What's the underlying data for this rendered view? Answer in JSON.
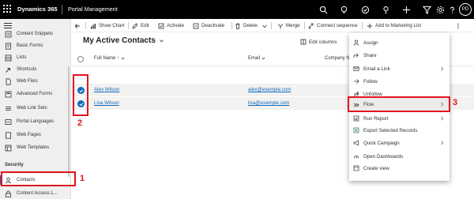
{
  "topbar": {
    "brand": "Dynamics 365",
    "app_name": "Portal Management",
    "avatar_initials": "PD",
    "icons": [
      "search-icon",
      "lightbulb-icon",
      "task-icon",
      "pin-icon",
      "plus-icon",
      "filter-icon",
      "gear-icon",
      "help-icon",
      "avatar"
    ]
  },
  "sidebar": {
    "items": [
      {
        "label": "Content Snippets",
        "icon": "snippet-icon"
      },
      {
        "label": "Basic Forms",
        "icon": "form-icon"
      },
      {
        "label": "Lists",
        "icon": "list-icon"
      },
      {
        "label": "Shortcuts",
        "icon": "shortcut-icon"
      },
      {
        "label": "Web Files",
        "icon": "file-icon"
      },
      {
        "label": "Advanced Forms",
        "icon": "form-icon"
      },
      {
        "label": "Web Link Sets",
        "icon": "link-icon"
      },
      {
        "label": "Portal Languages",
        "icon": "language-icon"
      },
      {
        "label": "Web Pages",
        "icon": "page-icon"
      },
      {
        "label": "Web Templates",
        "icon": "template-icon"
      }
    ],
    "section_label": "Security",
    "security_items": [
      {
        "label": "Contacts",
        "icon": "person-icon"
      },
      {
        "label": "Content Access L...",
        "icon": "lock-icon"
      }
    ]
  },
  "commandbar": {
    "back_icon": "back-arrow-icon",
    "items": [
      {
        "label": "Show Chart",
        "icon": "chart-icon"
      },
      {
        "label": "Edit",
        "icon": "edit-icon"
      },
      {
        "label": "Activate",
        "icon": "activate-icon"
      },
      {
        "label": "Deactivate",
        "icon": "deactivate-icon"
      },
      {
        "label": "Delete",
        "icon": "delete-icon"
      },
      {
        "label": "Merge",
        "icon": "merge-icon"
      },
      {
        "label": "Connect sequence",
        "icon": "sequence-icon"
      },
      {
        "label": "Add to Marketing List",
        "icon": "add-icon"
      }
    ],
    "more_icon": "more-icon"
  },
  "view": {
    "title": "My Active Contacts",
    "edit_columns": "Edit columns"
  },
  "grid": {
    "columns": [
      "Full Name ↑",
      "Email",
      "Company N"
    ],
    "rows": [
      {
        "name": "Alex Wilson",
        "email": "alex@example.com"
      },
      {
        "name": "Lisa Wilson",
        "email": "lisa@example.com"
      }
    ]
  },
  "flyout": {
    "items": [
      {
        "label": "Assign",
        "icon": "assign-icon",
        "chevron": false
      },
      {
        "label": "Share",
        "icon": "share-icon",
        "chevron": false
      },
      {
        "label": "Email a Link",
        "icon": "email-icon",
        "chevron": true
      },
      {
        "label": "Follow",
        "icon": "follow-icon",
        "chevron": false
      },
      {
        "label": "Unfollow",
        "icon": "unfollow-icon",
        "chevron": false
      },
      {
        "label": "Flow",
        "icon": "flow-icon",
        "chevron": true
      },
      {
        "label": "Run Report",
        "icon": "report-icon",
        "chevron": true
      },
      {
        "label": "Export Selected Records",
        "icon": "export-icon",
        "chevron": false
      },
      {
        "label": "Quick Campaign",
        "icon": "campaign-icon",
        "chevron": true
      },
      {
        "label": "Open Dashboards",
        "icon": "dashboard-icon",
        "chevron": false
      },
      {
        "label": "Create view",
        "icon": "view-icon",
        "chevron": false
      }
    ]
  },
  "annotations": {
    "labels": [
      "1",
      "2",
      "3"
    ],
    "color": "#e0161d"
  },
  "colors": {
    "topbar": "#000000",
    "accent": "#0f6cbd",
    "sidebar_bg": "#efefef",
    "row_selected": "#f3f2f1"
  }
}
